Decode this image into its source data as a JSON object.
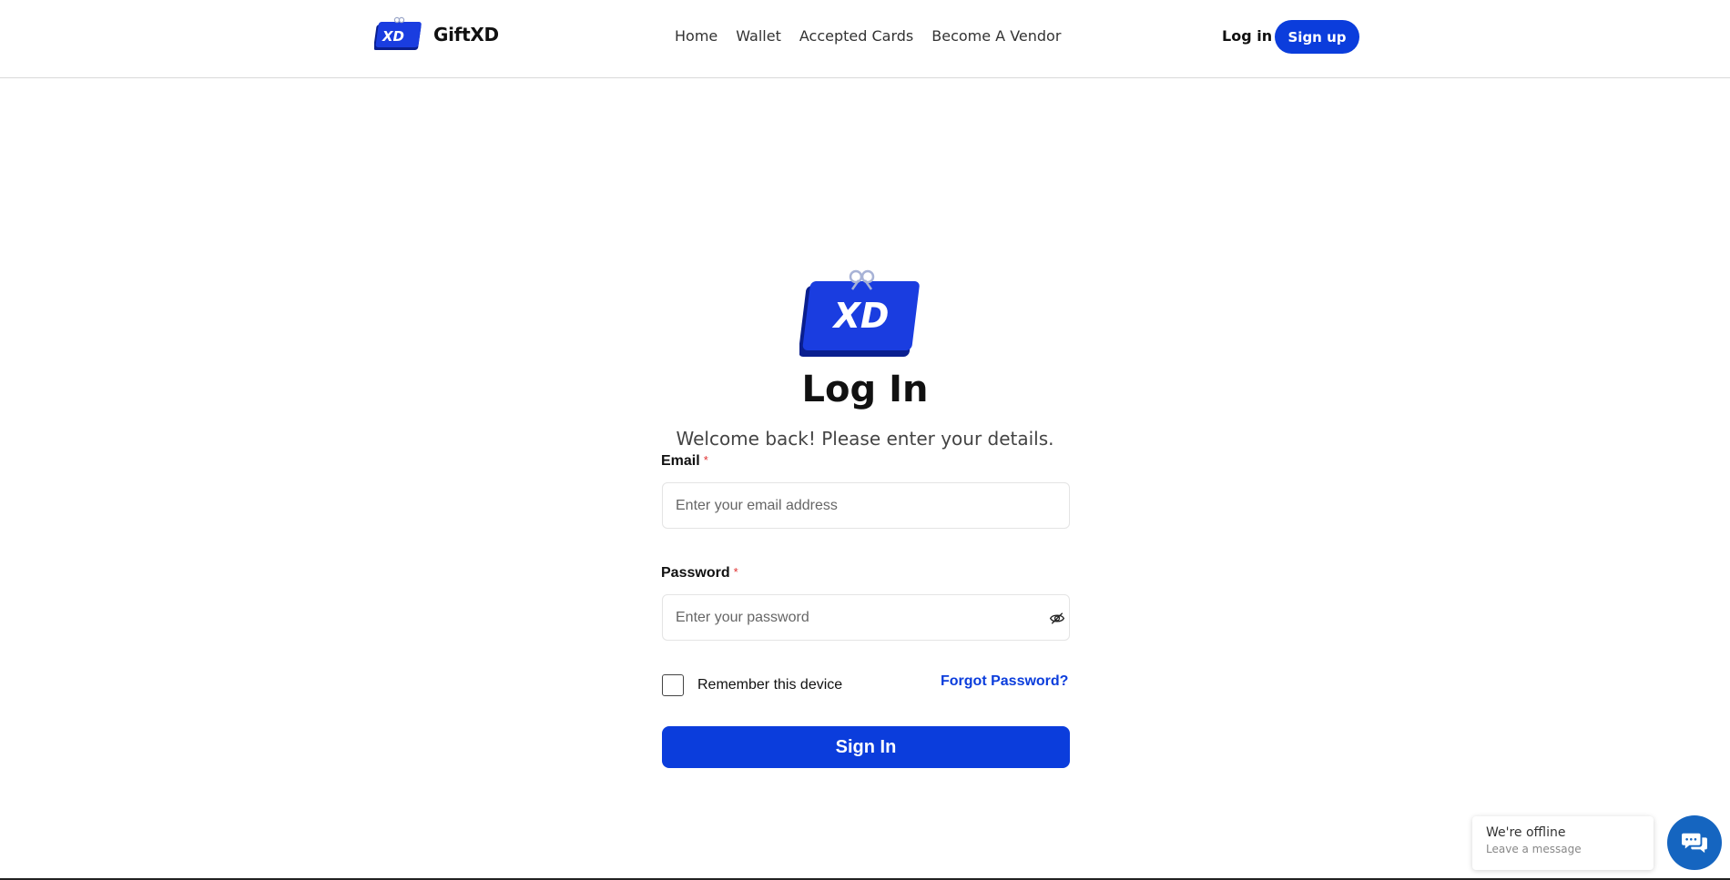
{
  "header": {
    "brand": "GiftXD",
    "logo_text": "XD",
    "nav": [
      {
        "label": "Home"
      },
      {
        "label": "Wallet"
      },
      {
        "label": "Accepted Cards"
      },
      {
        "label": "Become A Vendor"
      }
    ],
    "login_label": "Log in",
    "signup_label": "Sign up"
  },
  "login": {
    "logo_text": "XD",
    "title": "Log In",
    "subtitle": "Welcome back! Please enter your details.",
    "email_label": "Email",
    "email_placeholder": "Enter your email address",
    "password_label": "Password",
    "password_placeholder": "Enter your password",
    "required_mark": "*",
    "remember_label": "Remember this device",
    "remember_checked": false,
    "forgot_label": "Forgot Password?",
    "signin_label": "Sign In"
  },
  "chat": {
    "status": "We're offline",
    "sub": "Leave a message"
  },
  "colors": {
    "brand_blue": "#0b3ddc",
    "chat_blue": "#1565c0",
    "required_red": "#e03131"
  },
  "icons": {
    "password_toggle": "eye-slash-icon",
    "chat": "chat-bubbles-icon"
  }
}
